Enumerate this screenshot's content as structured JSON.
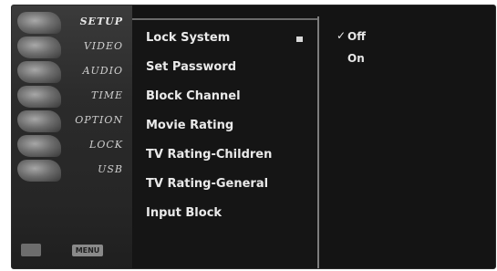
{
  "sidebar": {
    "items": [
      {
        "label": "SETUP",
        "icon": "setup-icon",
        "active": true
      },
      {
        "label": "VIDEO",
        "icon": "video-icon"
      },
      {
        "label": "AUDIO",
        "icon": "audio-icon"
      },
      {
        "label": "TIME",
        "icon": "time-icon"
      },
      {
        "label": "OPTION",
        "icon": "option-icon"
      },
      {
        "label": "LOCK",
        "icon": "lock-icon"
      },
      {
        "label": "USB",
        "icon": "usb-icon"
      }
    ],
    "bottom_key": "MENU"
  },
  "menu": {
    "items": [
      {
        "label": "Lock System",
        "selected": true
      },
      {
        "label": "Set Password"
      },
      {
        "label": "Block Channel"
      },
      {
        "label": "Movie Rating"
      },
      {
        "label": "TV Rating-Children"
      },
      {
        "label": "TV Rating-General"
      },
      {
        "label": "Input Block"
      }
    ]
  },
  "options": {
    "check_mark": "✓",
    "items": [
      {
        "label": "Off",
        "checked": true
      },
      {
        "label": "On",
        "checked": false
      }
    ]
  }
}
